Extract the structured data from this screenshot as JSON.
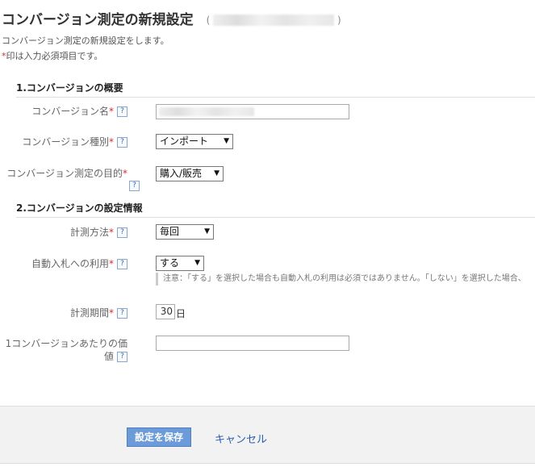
{
  "page": {
    "title": "コンバージョン測定の新規設定",
    "title_suffix_left": "(",
    "title_suffix_right": ")",
    "desc_line1": "コンバージョン測定の新規設定をします。",
    "desc_required_mark": "*",
    "desc_line2": "印は入力必須項目です。"
  },
  "section1": {
    "heading": "1.コンバージョンの概要",
    "name_label": "コンバージョン名",
    "name_value": "___",
    "type_label": "コンバージョン種別",
    "type_value": "インポート",
    "purpose_label": "コンバージョン測定の目的",
    "purpose_value": "購入/販売"
  },
  "section2": {
    "heading": "2.コンバージョンの設定情報",
    "method_label": "計測方法",
    "method_value": "毎回",
    "autobid_label": "自動入札への利用",
    "autobid_value": "する",
    "autobid_note": "注意：「する」を選択した場合も自動入札の利用は必須ではありません。「しない」を選択した場合、",
    "period_label": "計測期間",
    "period_value": "30",
    "period_unit": "日",
    "value_label_line1": "1コンバージョンあたりの価",
    "value_label_line2": "値",
    "value_value": ""
  },
  "common": {
    "required_mark": "*",
    "help_glyph": "?"
  },
  "footer": {
    "save_label": "設定を保存",
    "cancel_label": "キャンセル"
  },
  "colors": {
    "required": "#d03030",
    "save_button": "#6b9bd8",
    "link": "#2a5db0",
    "footer_bg": "#f2f2f2"
  }
}
